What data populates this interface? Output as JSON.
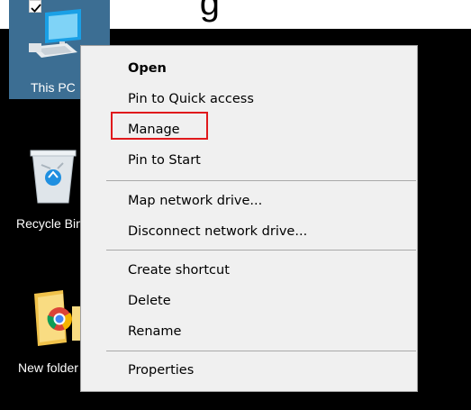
{
  "banner": {
    "text": "], ... ... g ..."
  },
  "desktop": {
    "icons": [
      {
        "label": "This PC",
        "icon": "this-pc-icon",
        "selected": true
      },
      {
        "label": "Recycle Bin",
        "icon": "recycle-bin-icon",
        "selected": false
      },
      {
        "label": "New folder",
        "icon": "folder-icon",
        "selected": false
      }
    ]
  },
  "context_menu": {
    "items": [
      {
        "label": "Open",
        "bold": true
      },
      {
        "label": "Pin to Quick access"
      },
      {
        "label": "Manage",
        "highlighted": true
      },
      {
        "label": "Pin to Start"
      },
      {
        "label": "Map network drive..."
      },
      {
        "label": "Disconnect network drive..."
      },
      {
        "label": "Create shortcut"
      },
      {
        "label": "Delete"
      },
      {
        "label": "Rename"
      },
      {
        "label": "Properties"
      }
    ]
  },
  "colors": {
    "selection": "#3c6e93",
    "highlight_border": "#e0191c",
    "menu_bg": "#f0f0f0"
  }
}
